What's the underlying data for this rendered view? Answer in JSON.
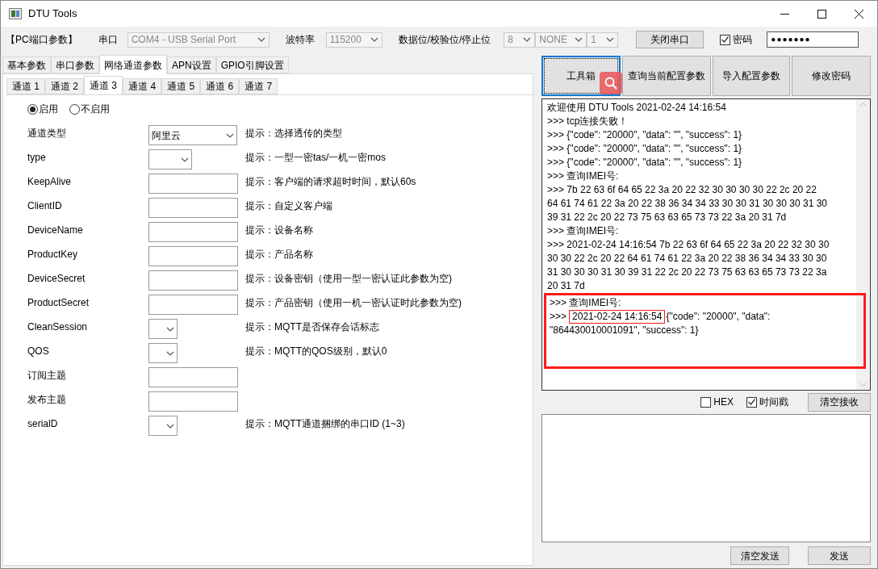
{
  "window": {
    "title": "DTU Tools"
  },
  "port_bar": {
    "section_label": "【PC端口参数】",
    "port_label": "串口",
    "port_value": "COM4 - USB Serial Port",
    "baud_label": "波特率",
    "baud_value": "115200",
    "format_label": "数据位/校验位/停止位",
    "data_bits": "8",
    "parity": "NONE",
    "stop_bits": "1",
    "close_button": "关闭串口",
    "password_label": "密码",
    "password_checked": true,
    "password_value": "●●●●●●●"
  },
  "tabs": [
    {
      "label": "基本参数",
      "selected": false
    },
    {
      "label": "串口参数",
      "selected": false
    },
    {
      "label": "网络通道参数",
      "selected": true
    },
    {
      "label": "APN设置",
      "selected": false
    },
    {
      "label": "GPIO引脚设置",
      "selected": false
    }
  ],
  "channel_tabs": [
    {
      "label": "通道 1",
      "selected": false
    },
    {
      "label": "通道 2",
      "selected": false
    },
    {
      "label": "通道 3",
      "selected": true
    },
    {
      "label": "通道 4",
      "selected": false
    },
    {
      "label": "通道 5",
      "selected": false
    },
    {
      "label": "通道 6",
      "selected": false
    },
    {
      "label": "通道 7",
      "selected": false
    }
  ],
  "enable_options": [
    {
      "label": "启用",
      "selected": true
    },
    {
      "label": "不启用",
      "selected": false
    }
  ],
  "fields": [
    {
      "label": "通道类型",
      "kind": "combo",
      "value": "阿里云",
      "hint": "提示：选择透传的类型"
    },
    {
      "label": "type",
      "kind": "shortcombo",
      "hint": "提示：一型一密tas/一机一密mos"
    },
    {
      "label": "KeepAlive",
      "kind": "text",
      "hint": "提示：客户端的请求超时时间，默认60s"
    },
    {
      "label": "ClientID",
      "kind": "text",
      "hint": "提示：自定义客户端"
    },
    {
      "label": "DeviceName",
      "kind": "text",
      "hint": "提示：设备名称"
    },
    {
      "label": "ProductKey",
      "kind": "text",
      "hint": "提示：产品名称"
    },
    {
      "label": "DeviceSecret",
      "kind": "text",
      "hint": "提示：设备密钥（使用一型一密认证此参数为空)"
    },
    {
      "label": "ProductSecret",
      "kind": "text",
      "hint": "提示：产品密钥（使用一机一密认证时此参数为空)"
    },
    {
      "label": "CleanSession",
      "kind": "minicombo",
      "hint": "提示：MQTT是否保存会话标志"
    },
    {
      "label": "QOS",
      "kind": "minicombo",
      "hint": "提示：MQTT的QOS级别，默认0"
    },
    {
      "label": "订阅主题",
      "kind": "text"
    },
    {
      "label": "发布主题",
      "kind": "text"
    },
    {
      "label": "serialD",
      "kind": "minicombo",
      "hint": "提示：MQTT通道捆绑的串口ID (1~3)"
    }
  ],
  "action_buttons": [
    {
      "label": "工具箱",
      "focused": true
    },
    {
      "label": "查询当前配置参数",
      "focused": false
    },
    {
      "label": "导入配置参数",
      "focused": false
    },
    {
      "label": "修改密码",
      "focused": false
    }
  ],
  "log_lines": [
    "欢迎使用 DTU Tools 2021-02-24 14:16:54",
    ">>> tcp连接失败！",
    ">>> {\"code\": \"20000\", \"data\": \"\", \"success\": 1}",
    ">>> {\"code\": \"20000\", \"data\": \"\", \"success\": 1}",
    ">>> {\"code\": \"20000\", \"data\": \"\", \"success\": 1}",
    ">>> 查询IMEI号:",
    ">>> 7b 22 63 6f 64 65 22 3a 20 22 32 30 30 30 30 22 2c 20 22",
    "64 61 74 61 22 3a 20 22 38 36 34 34 33 30 30 31 30 30 30 31 30",
    "39 31 22 2c 20 22 73 75 63 63 65 73 73 22 3a 20 31 7d",
    ">>> 查询IMEI号:",
    ">>> 2021-02-24 14:16:54 7b 22 63 6f 64 65 22 3a 20 22 32 30 30",
    "30 30 22 2c 20 22 64 61 74 61 22 3a 20 22 38 36 34 34 33 30 30",
    "31 30 30 30 31 30 39 31 22 2c 20 22 73 75 63 63 65 73 73 22 3a",
    "20 31 7d"
  ],
  "marked_block": {
    "first_line": ">>> 查询IMEI号:",
    "prefix": ">>>",
    "marked": "2021-02-24 14:16:54",
    "rest": "{\"code\": \"20000\", \"data\":",
    "last_line": "\"864430010001091\", \"success\": 1}"
  },
  "receive_options": [
    {
      "label": "HEX",
      "checked": false
    },
    {
      "label": "时间戳",
      "checked": true
    }
  ],
  "clear_receive_button": "清空接收",
  "clear_send_button": "清空发送",
  "send_button": "发送"
}
